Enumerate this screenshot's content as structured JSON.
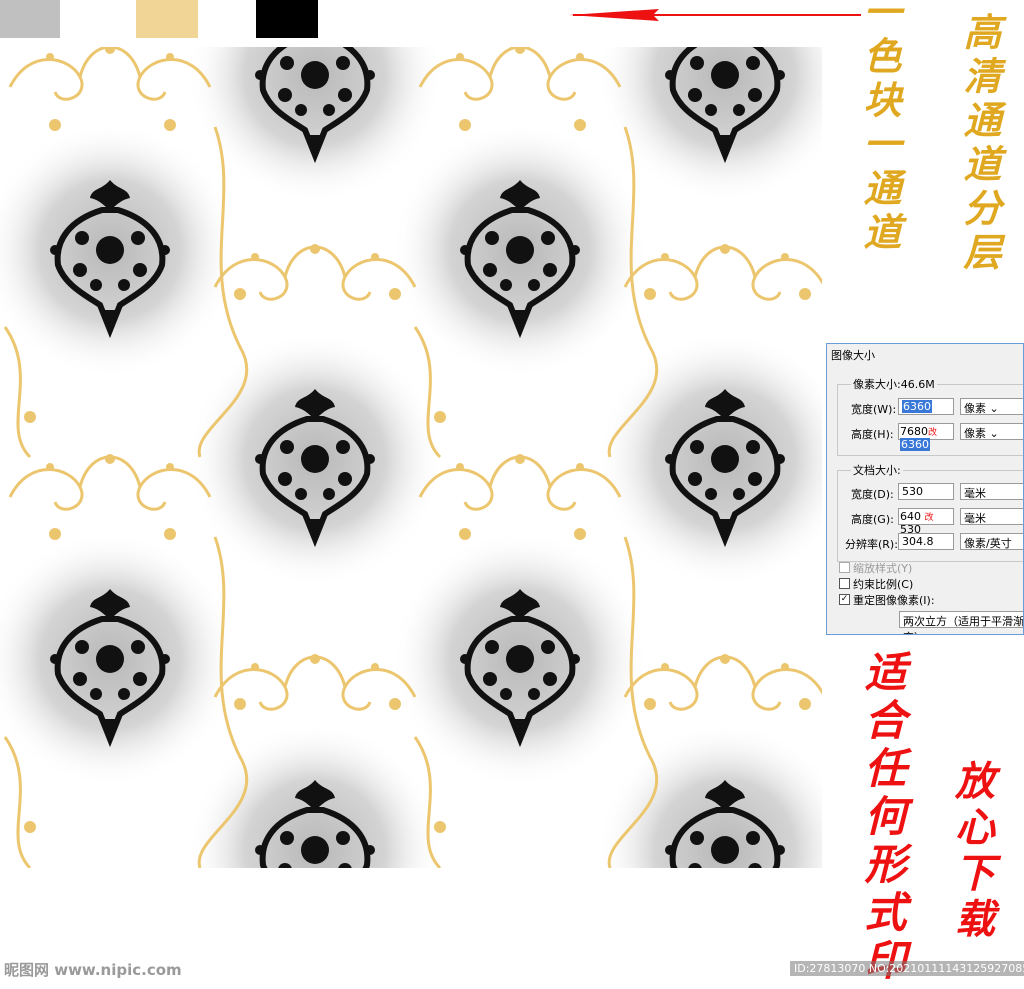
{
  "swatches": [
    {
      "color": "#c0c0c0"
    },
    {
      "color": "#ffffff"
    },
    {
      "color": "#f0d596"
    },
    {
      "color": "#000000"
    }
  ],
  "colors": {
    "gold": "#ecc66e",
    "gold_text": "#e0a820",
    "red": "#ee1111",
    "arrow": "#e11"
  },
  "text_left": "一色块一通道",
  "text_right": "高清通道分层",
  "text_print": "适合任何形式印",
  "text_download": "放心下载",
  "dialog": {
    "title": "图像大小",
    "pixel_size": "像素大小:46.6M",
    "width_label": "宽度(W):",
    "width_value": "6360",
    "width_unit": "像素",
    "height_label": "高度(H):",
    "height_old": "7680",
    "height_change": "改",
    "height_value": "6360",
    "height_unit": "像素",
    "doc_size": "文档大小:",
    "doc_width_label": "宽度(D):",
    "doc_width_value": "530",
    "doc_width_unit": "毫米",
    "doc_height_label": "高度(G):",
    "doc_height_old": "640",
    "doc_height_change": "改",
    "doc_height_value": "530",
    "doc_height_unit": "毫米",
    "resolution_label": "分辨率(R):",
    "resolution_value": "304.8",
    "resolution_unit": "像素/英寸",
    "scale_styles": "缩放样式(Y)",
    "constrain": "约束比例(C)",
    "resample": "重定图像像素(I):",
    "resample_method": "两次立方（适用于平滑渐变）"
  },
  "watermark_left": "昵图网 www.nipic.com",
  "watermark_right": "ID:27813070 NO:20210111143125927085"
}
